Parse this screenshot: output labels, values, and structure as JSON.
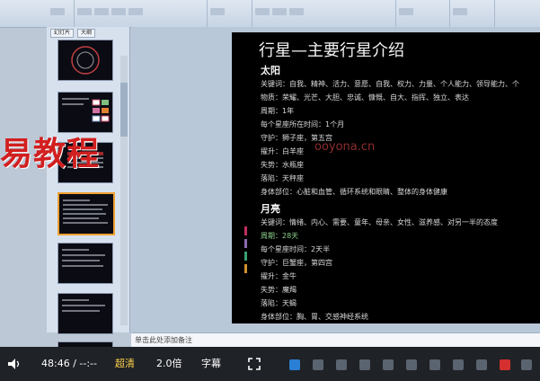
{
  "ribbon": {
    "groups": [
      "",
      "",
      "",
      "",
      "",
      ""
    ]
  },
  "left_panel": {
    "tabs": [
      "幻灯片",
      "大纲"
    ],
    "slide_numbers": [
      "",
      "",
      "",
      "",
      "",
      "",
      ""
    ]
  },
  "watermark": {
    "text": "易教程"
  },
  "slide": {
    "title": "行星—主要行星介绍",
    "watermark_url": "ooyona.cn",
    "sections": [
      {
        "heading": "太阳",
        "lines": [
          "关键词：自我、精神、活力、意愿、自我、权力、力量、个人能力、领导能力、个",
          "物质：荣耀、光芒、大胆、忠诚、慷慨、自大、指挥、独立、表达",
          "周期：1年",
          "每个星座所在时间：1个月",
          "守护：狮子座，第五宫",
          "擢升：白羊座",
          "失势：水瓶座",
          "落陷：天秤座",
          "身体部位：心脏和血管、循环系统和眼睛、整体的身体健康"
        ]
      },
      {
        "heading": "月亮",
        "lines": [
          "关键词：情绪、内心、需要、童年、母亲、女性、滋养感、对另一半的态度",
          "周期：28天",
          "每个星座时间：2天半",
          "守护：巨蟹座，第四宫",
          "擢升：金牛",
          "失势：魔羯",
          "落陷：天蝎",
          "身体部位：胸、胃、交感神经系统"
        ]
      }
    ]
  },
  "notes": {
    "placeholder": "单击此处添加备注"
  },
  "player": {
    "time": "48:46 / --:--",
    "quality": "超清",
    "speed": "2.0倍",
    "subtitle": "字幕"
  }
}
